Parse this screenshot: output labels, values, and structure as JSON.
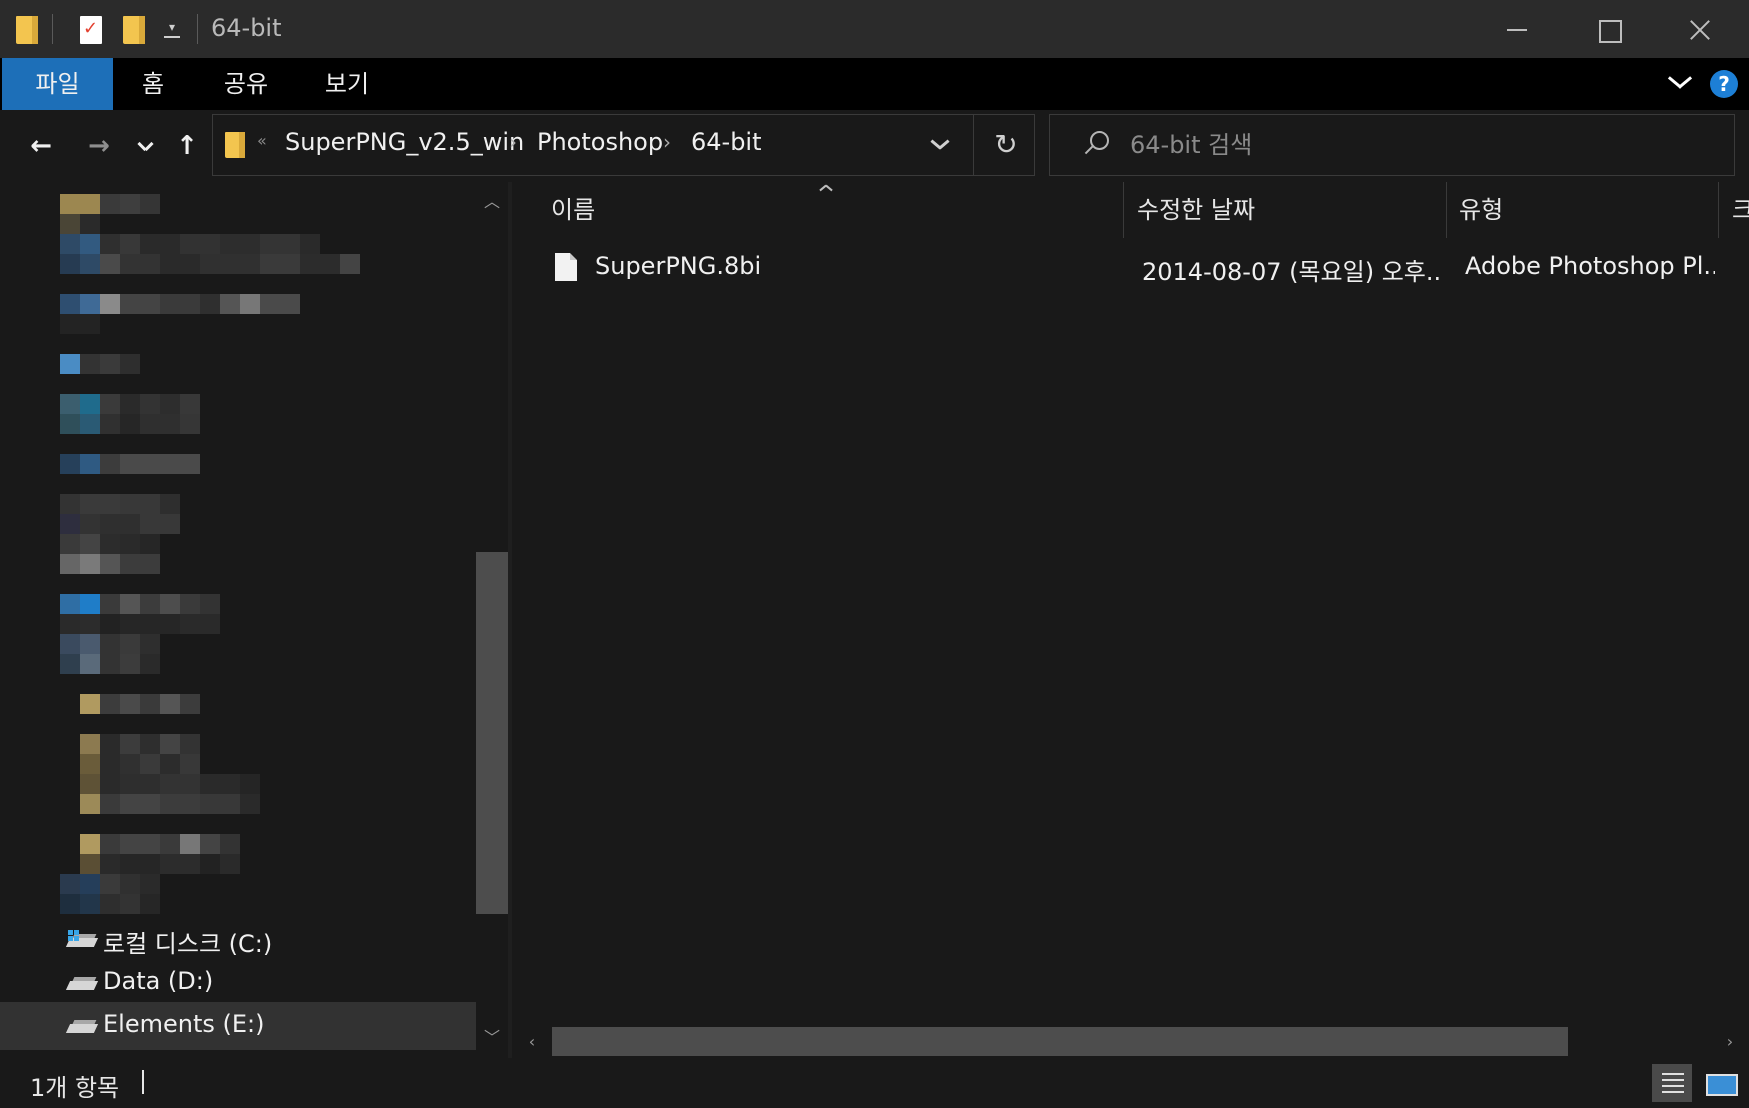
{
  "window": {
    "title": "64-bit"
  },
  "quick_access": {
    "items": [
      "folder-icon",
      "properties-icon",
      "new-folder-icon"
    ],
    "dropdown_glyph": "▾"
  },
  "ribbon": {
    "tabs": [
      {
        "label": "파일",
        "active": true
      },
      {
        "label": "홈"
      },
      {
        "label": "공유"
      },
      {
        "label": "보기"
      }
    ],
    "help_label": "?"
  },
  "nav": {
    "back_glyph": "←",
    "forward_glyph": "→",
    "up_glyph": "↑",
    "refresh_glyph": "↻",
    "overflow_glyph": "«",
    "breadcrumbs": [
      "SuperPNG_v2.5_win",
      "Photoshop",
      "64-bit"
    ],
    "separator_glyph": "›"
  },
  "search": {
    "placeholder": "64-bit 검색",
    "value": ""
  },
  "sidebar": {
    "drives": [
      {
        "label": "로컬 디스크 (C:)",
        "icon": "system-drive-icon"
      },
      {
        "label": "Data (D:)",
        "icon": "drive-icon"
      },
      {
        "label": "Elements (E:)",
        "icon": "drive-icon",
        "selected": true
      }
    ]
  },
  "content": {
    "columns": [
      "이름",
      "수정한 날짜",
      "유형",
      "크"
    ],
    "files": [
      {
        "name": "SuperPNG.8bi",
        "modified": "2014-08-07 (목요일) 오후...",
        "type": "Adobe Photoshop Pl..."
      }
    ]
  },
  "status": {
    "item_count": "1개 항목"
  },
  "colors": {
    "accent": "#1d6fb8",
    "background": "#191919",
    "titlebar": "#2b2b2b"
  }
}
